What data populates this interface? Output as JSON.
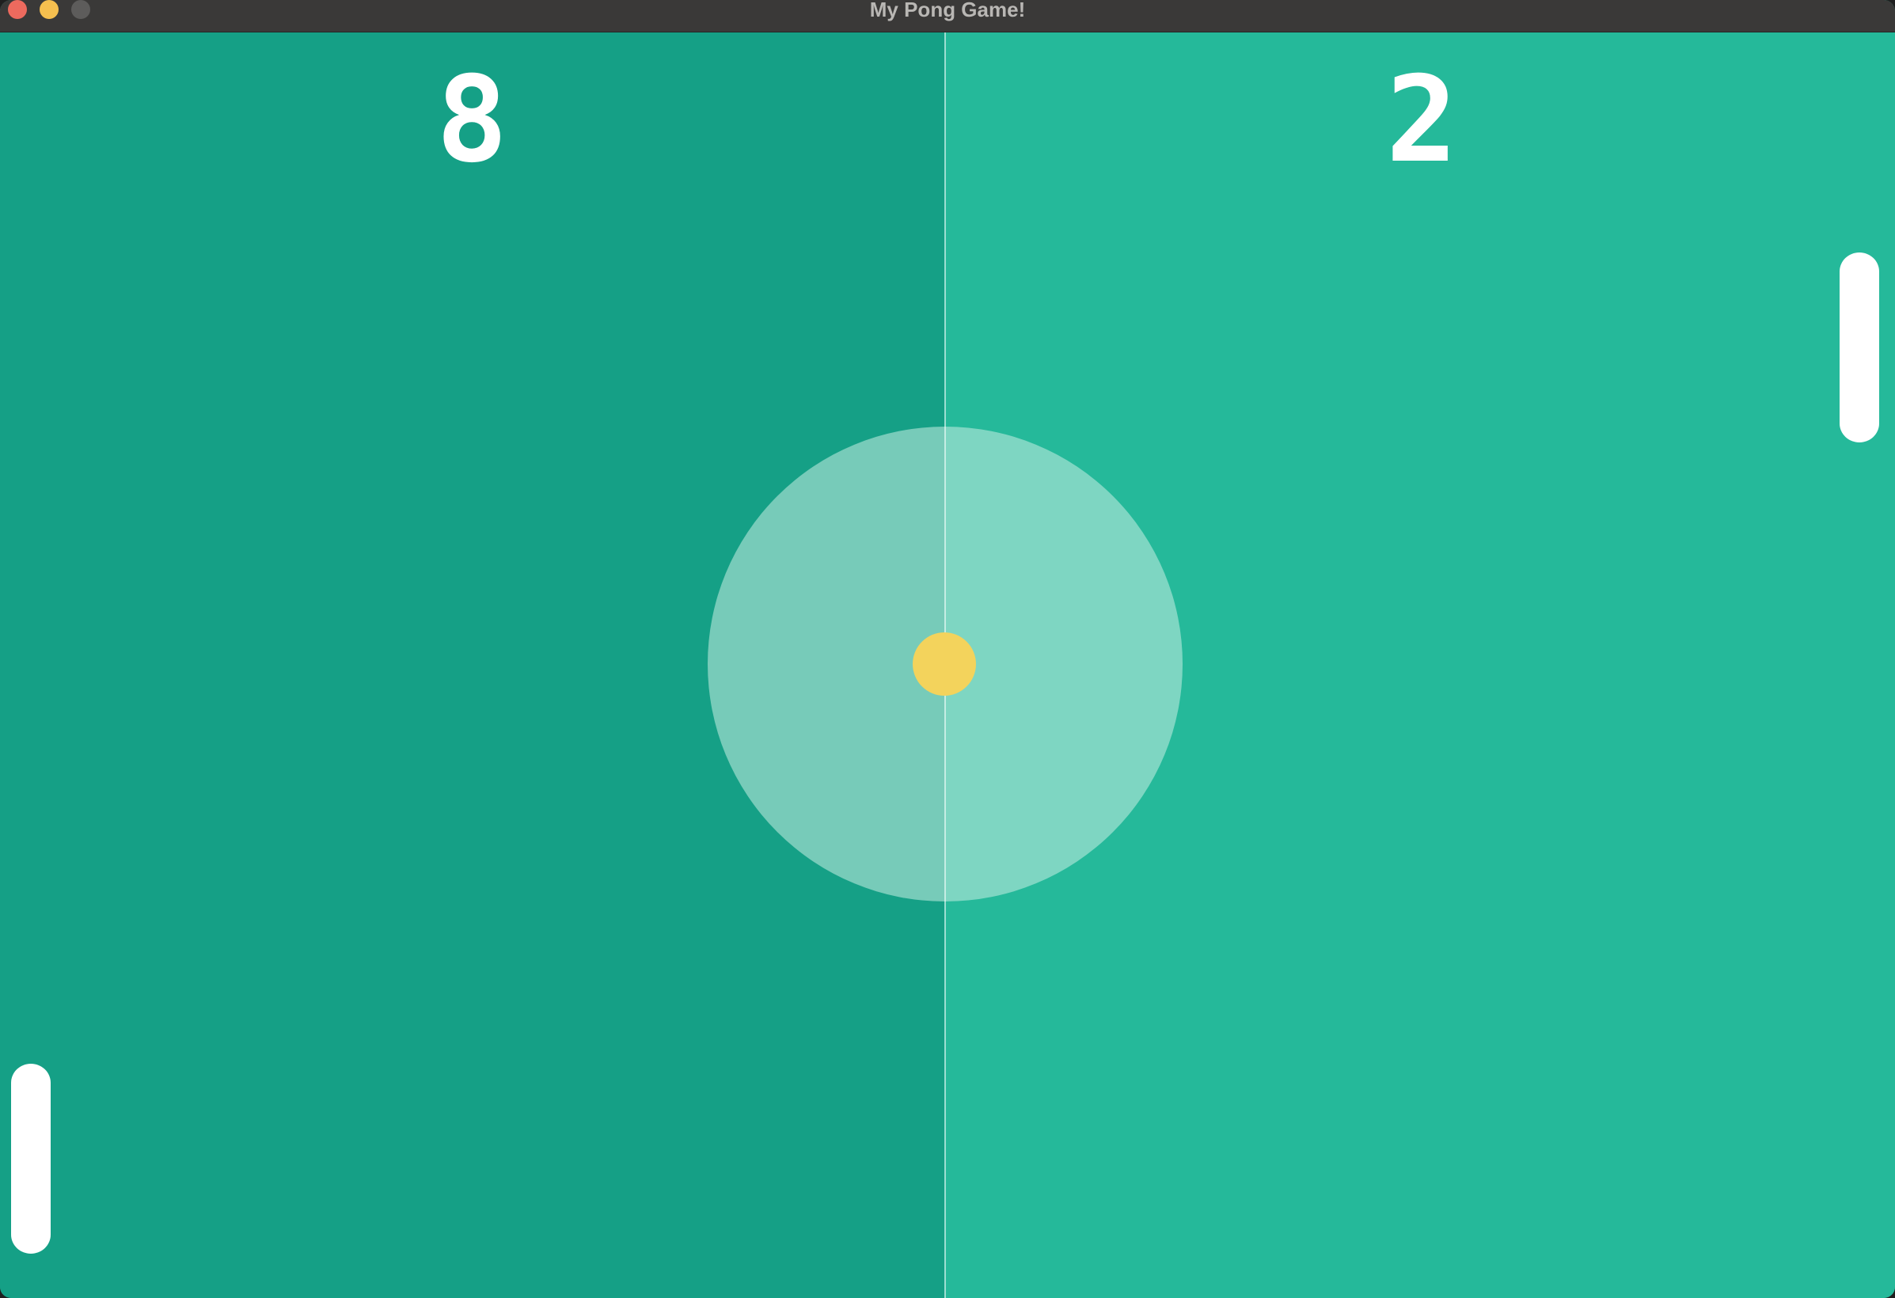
{
  "window": {
    "title": "My Pong Game!"
  },
  "scoreboard": {
    "left_score": "8",
    "right_score": "2"
  },
  "colors": {
    "court_left": "#15a086",
    "court_right": "#25b99a",
    "center_circle": "#c8efe3",
    "ball": "#f3d35c",
    "paddle": "#ffffff"
  },
  "icons": {
    "close": "traffic-light-close-icon",
    "minimize": "traffic-light-minimize-icon",
    "zoom": "traffic-light-zoom-icon"
  }
}
